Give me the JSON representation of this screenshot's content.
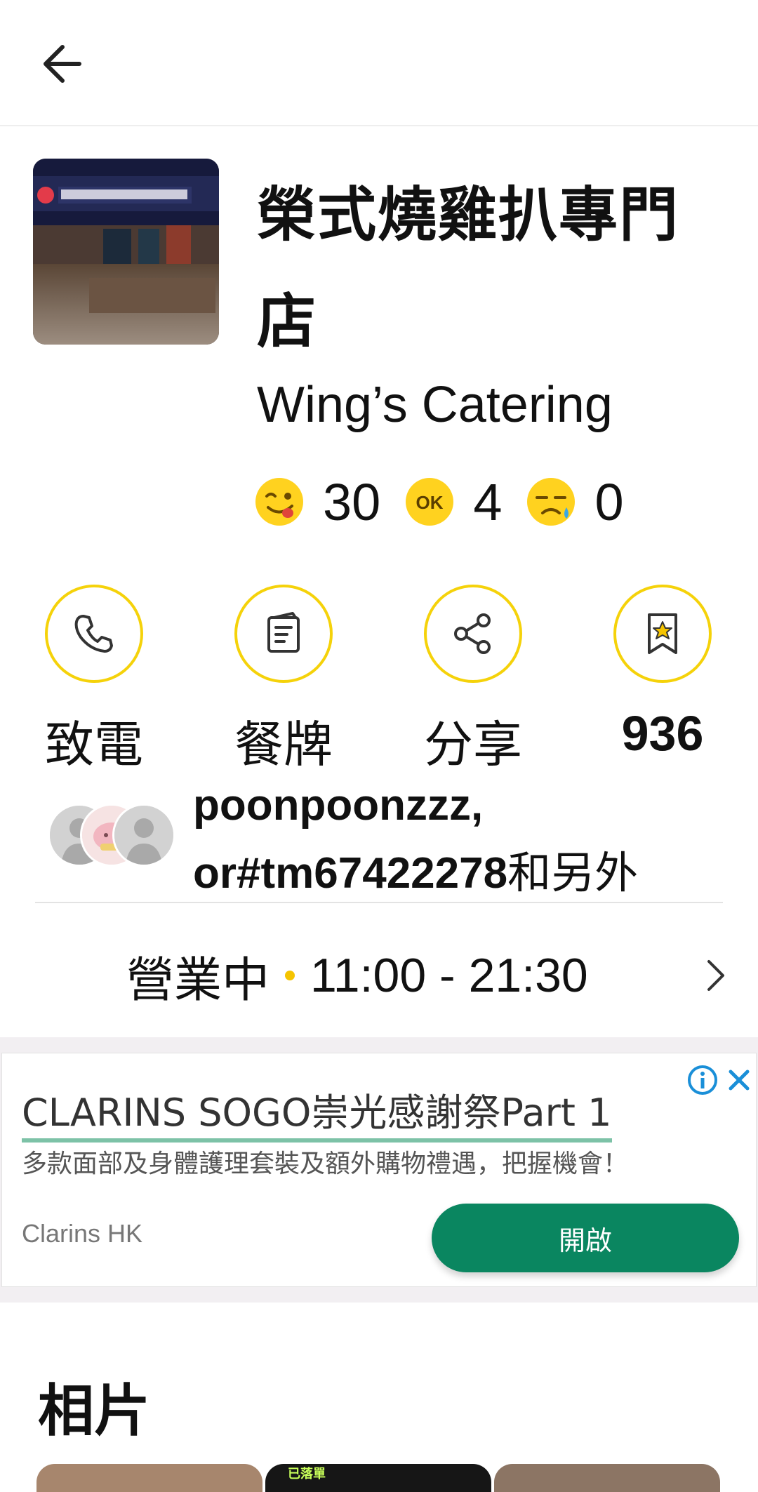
{
  "restaurant": {
    "name": "榮式燒雞扒專門店",
    "english_name": "Wing’s Catering",
    "reactions": [
      {
        "icon": "yummy-face-icon",
        "count": "30"
      },
      {
        "icon": "ok-face-icon",
        "count": "4"
      },
      {
        "icon": "sad-face-icon",
        "count": "0"
      }
    ]
  },
  "actions": {
    "call_label": "致電",
    "menu_label": "餐牌",
    "share_label": "分享",
    "bookmark_count": "936"
  },
  "bookmarked_by": {
    "names": "poonpoonzzz, or#tm67422278",
    "suffix": "和另外"
  },
  "hours": {
    "status": "營業中",
    "time": "11:00 - 21:30"
  },
  "ad": {
    "title": "CLARINS SOGO崇光感謝祭Part 1",
    "body": "多款面部及身體護理套裝及額外購物禮遇，把握機會！",
    "advertiser": "Clarins HK",
    "cta": "開啟"
  },
  "photos": {
    "title": "相片",
    "tag": "已落單"
  },
  "colors": {
    "accent_yellow": "#f5d20a",
    "ad_button": "#0a8660",
    "ad_underline": "#7dc2a7"
  }
}
